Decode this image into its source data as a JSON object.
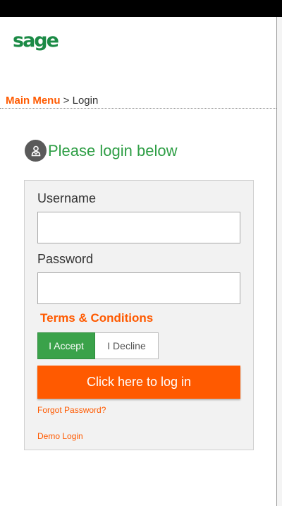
{
  "brand": {
    "logo_text": "sage",
    "color": "#1b8a45"
  },
  "breadcrumb": {
    "parent": "Main Menu",
    "separator": ">",
    "current": "Login"
  },
  "login": {
    "heading": "Please login below",
    "heading_icon": "user-circle-icon",
    "username_label": "Username",
    "username_value": "",
    "password_label": "Password",
    "password_value": "",
    "terms_label": "Terms & Conditions",
    "accept_label": "I Accept",
    "decline_label": "I Decline",
    "terms_selected": "accept",
    "submit_label": "Click here to log in",
    "forgot_label": "Forgot Password?",
    "demo_label": "Demo Login"
  },
  "colors": {
    "accent_orange": "#ff5a00",
    "accept_green": "#3aa24a",
    "heading_green": "#2e9e45",
    "top_bar": "#000000",
    "panel_bg": "#f2f2f2"
  }
}
